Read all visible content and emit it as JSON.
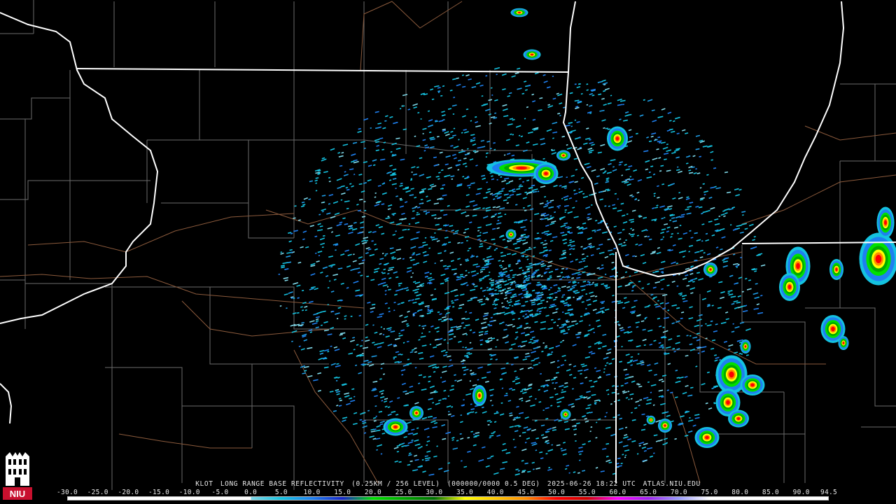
{
  "product": {
    "station": "KLOT",
    "description": "LONG RANGE BASE REFLECTIVITY",
    "resolution": "(0.25KM / 256 LEVEL)",
    "volume": "(000000/0000 0.5 DEG)",
    "timestamp": "2025-06-26 18:22 UTC",
    "source": "ATLAS.NIU.EDU"
  },
  "logo": {
    "text": "NIU",
    "icon": "niu-logo-icon",
    "color": "#c8102e"
  },
  "colorbar": {
    "ticks": [
      "-30.0",
      "-25.0",
      "-20.0",
      "-15.0",
      "-10.0",
      "-5.0",
      "0.0",
      "5.0",
      "10.0",
      "15.0",
      "20.0",
      "25.0",
      "30.0",
      "35.0",
      "40.0",
      "45.0",
      "50.0",
      "55.0",
      "60.0",
      "65.0",
      "70.0",
      "75.0",
      "80.0",
      "85.0",
      "90.0",
      "94.5"
    ],
    "colors": {
      "below_zero": "#ffffff",
      "0": "#7fd8e8",
      "5": "#14c2e0",
      "10": "#1e7ff0",
      "15": "#1626c8",
      "20": "#00e000",
      "25": "#00a800",
      "30": "#007000",
      "35": "#ffff00",
      "40": "#ffc800",
      "45": "#ff8c00",
      "50": "#ff0000",
      "55": "#d00000",
      "60": "#ff00ff",
      "65": "#a020f0",
      "70": "#9a9aff",
      "75": "#ffffff"
    }
  },
  "map_colors": {
    "background": "#000000",
    "state_lines": "#ffffff",
    "county_lines": "#6b6b6b",
    "highways": "#8b5a3c"
  }
}
